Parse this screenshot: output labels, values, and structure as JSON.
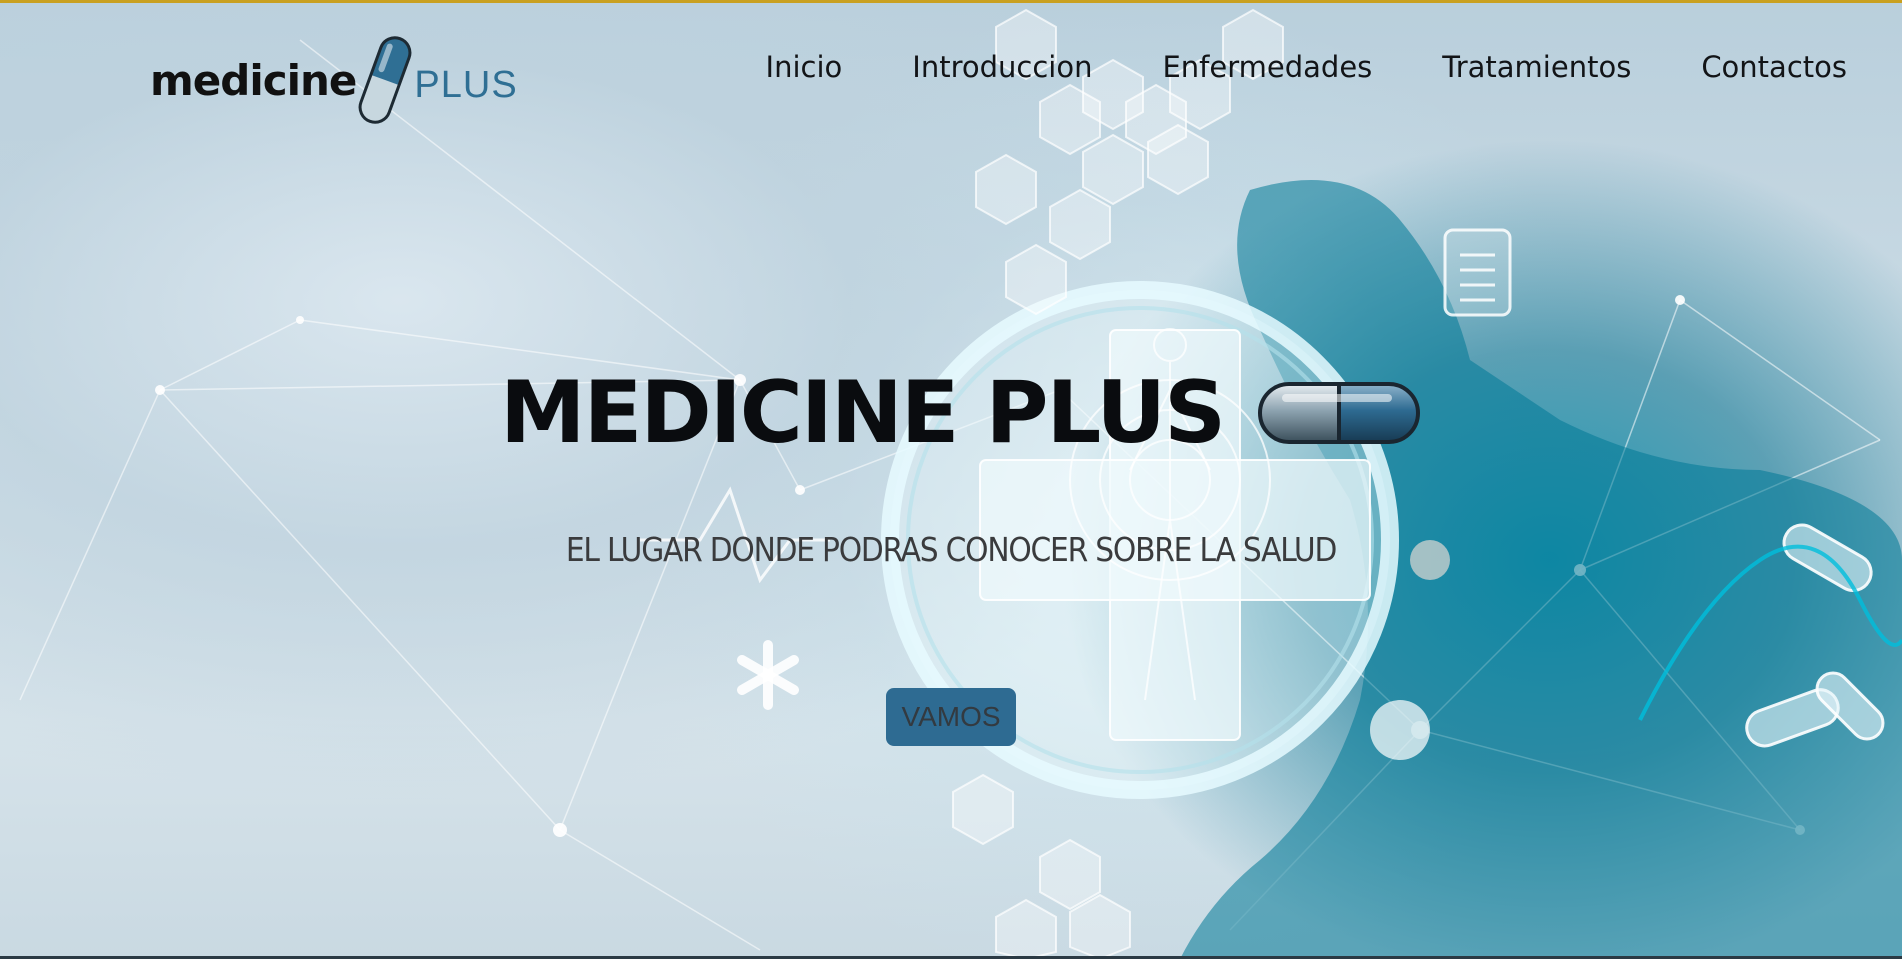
{
  "brand": {
    "logo_word": "medicine",
    "logo_suffix": "PLUS"
  },
  "nav": {
    "items": [
      {
        "label": "Inicio"
      },
      {
        "label": "Introduccion"
      },
      {
        "label": "Enfermedades"
      },
      {
        "label": "Tratamientos"
      },
      {
        "label": "Contactos"
      }
    ]
  },
  "hero": {
    "title": "MEDICINE PLUS",
    "subtitle": "EL LUGAR DONDE PODRAS CONOCER SOBRE LA SALUD",
    "button_label": "VAMOS"
  },
  "colors": {
    "accent": "#2e6b92",
    "text_dark": "#121417",
    "background": "#c9dbe5"
  },
  "icons": [
    "capsule-icon",
    "medical-cross-icon",
    "hexagon-icon",
    "clipboard-icon",
    "asterisk-icon",
    "heartbeat-line-icon"
  ]
}
